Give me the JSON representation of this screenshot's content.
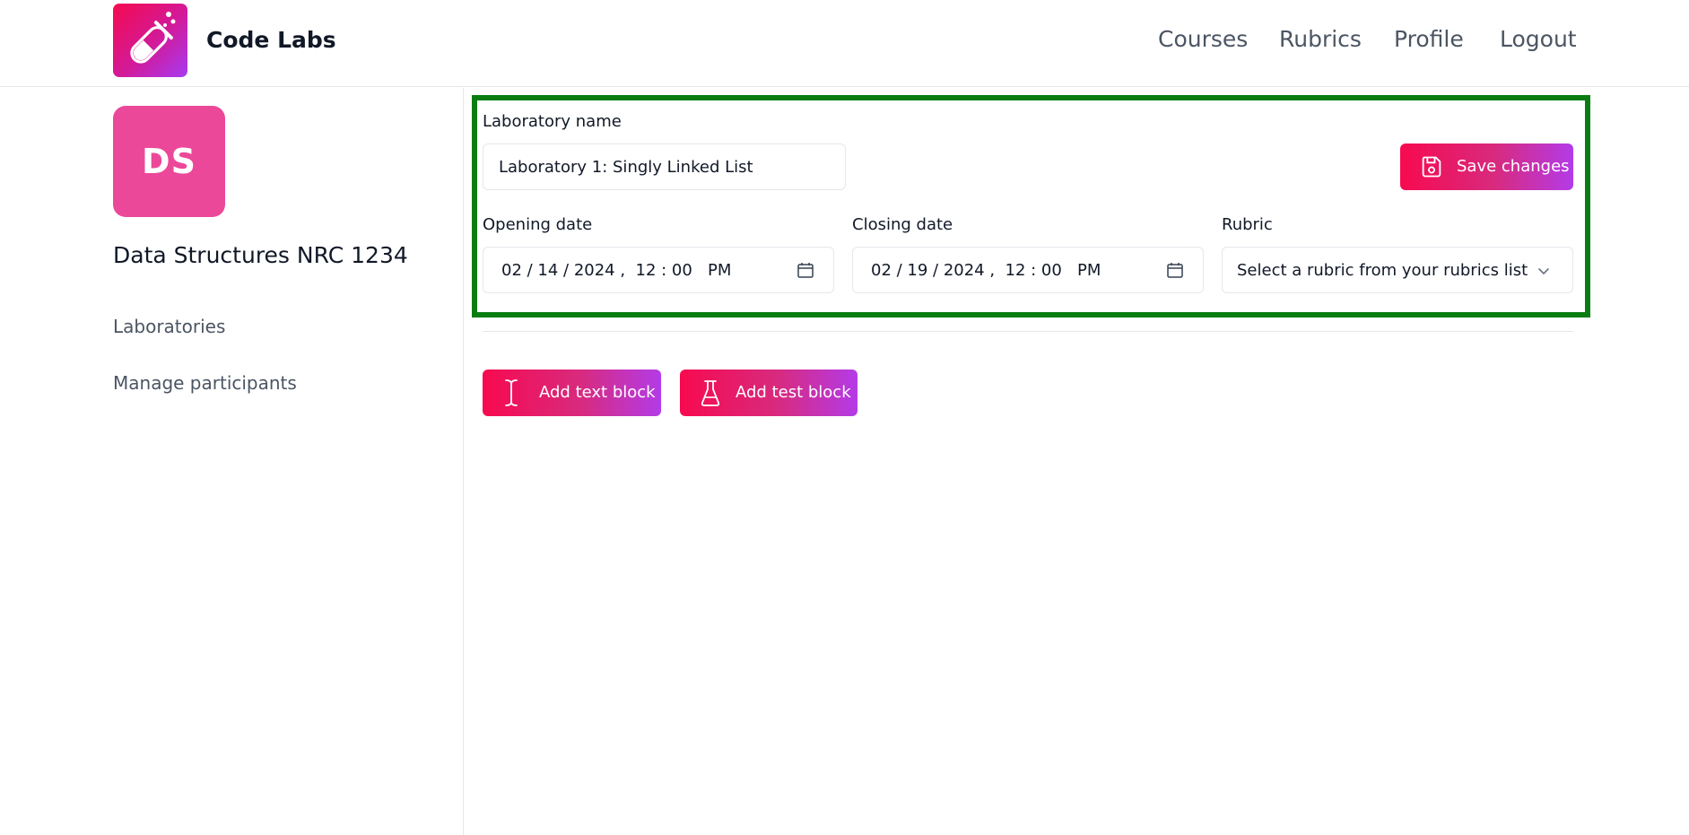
{
  "header": {
    "brand": "Code Labs",
    "nav": [
      "Courses",
      "Rubrics",
      "Profile",
      "Logout"
    ]
  },
  "sidebar": {
    "avatar_initials": "DS",
    "course_title": "Data Structures NRC 1234",
    "links": [
      "Laboratories",
      "Manage participants"
    ]
  },
  "form": {
    "name_label": "Laboratory name",
    "name_value": "Laboratory 1: Singly Linked List",
    "save_label": "Save changes",
    "opening_label": "Opening date",
    "opening_value": "02 / 14 / 2024 ,  12 : 00   PM",
    "closing_label": "Closing date",
    "closing_value": "02 / 19 / 2024 ,  12 : 00   PM",
    "rubric_label": "Rubric",
    "rubric_value": "Select a rubric from your rubrics list"
  },
  "actions": {
    "add_text_label": "Add text block",
    "add_test_label": "Add test block"
  },
  "colors": {
    "accent_start": "#f70a4f",
    "accent_end": "#b33be8",
    "avatar": "#ec4899",
    "highlight_border": "#0a7d12"
  }
}
